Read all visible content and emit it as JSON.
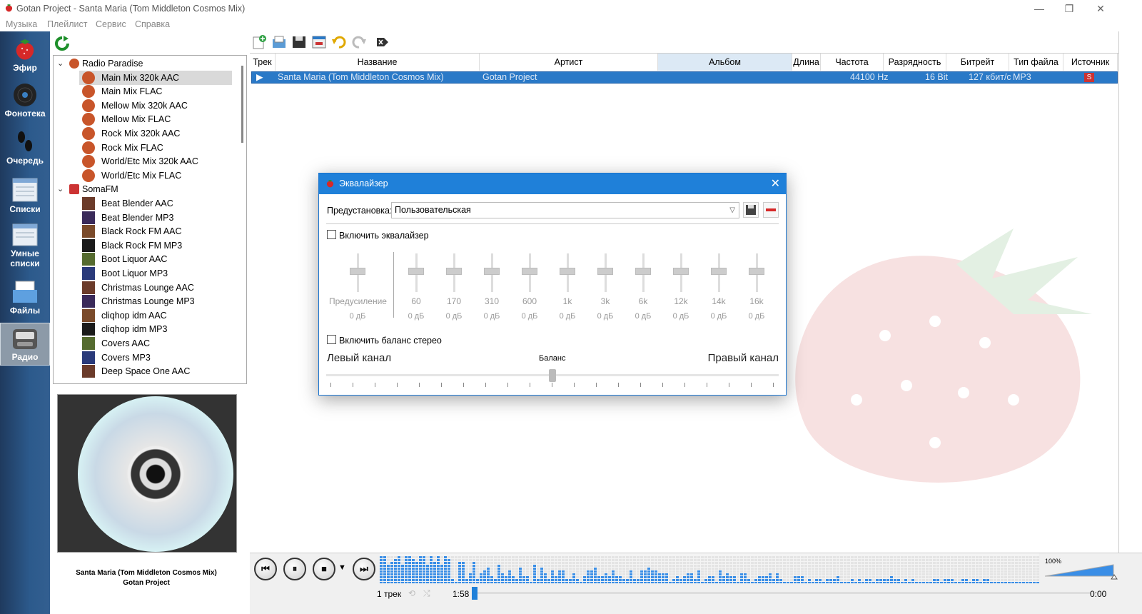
{
  "window": {
    "title": "Gotan Project - Santa Maria (Tom Middleton Cosmos Mix)",
    "minimize": "—",
    "maximize": "❐",
    "close": "✕"
  },
  "menu": [
    "Музыка",
    "Плейлист",
    "Сервис",
    "Справка"
  ],
  "nav": [
    {
      "label": "Эфир",
      "icon": "strawberry-icon"
    },
    {
      "label": "Фонотека",
      "icon": "vinyl-icon"
    },
    {
      "label": "Очередь",
      "icon": "footprints-icon"
    },
    {
      "label": "Списки",
      "icon": "playlists-icon"
    },
    {
      "label": "Умные списки",
      "icon": "smart-playlists-icon"
    },
    {
      "label": "Файлы",
      "icon": "files-icon"
    },
    {
      "label": "Радио",
      "icon": "radio-icon",
      "active": true
    }
  ],
  "tree": {
    "groups": [
      {
        "name": "Radio Paradise",
        "items": [
          "Main Mix 320k AAC",
          "Main Mix FLAC",
          "Mellow Mix 320k AAC",
          "Mellow Mix FLAC",
          "Rock Mix 320k AAC",
          "Rock Mix FLAC",
          "World/Etc Mix 320k AAC",
          "World/Etc Mix FLAC"
        ]
      },
      {
        "name": "SomaFM",
        "items": [
          "Beat Blender AAC",
          "Beat Blender MP3",
          "Black Rock FM AAC",
          "Black Rock FM MP3",
          "Boot Liquor AAC",
          "Boot Liquor MP3",
          "Christmas Lounge AAC",
          "Christmas Lounge MP3",
          "cliqhop idm AAC",
          "cliqhop idm MP3",
          "Covers AAC",
          "Covers MP3",
          "Deep Space One AAC"
        ]
      }
    ],
    "selected": "Main Mix 320k AAC"
  },
  "now_playing": {
    "title": "Santa Maria (Tom Middleton Cosmos Mix)",
    "artist": "Gotan Project"
  },
  "playlist": {
    "columns": [
      "Трек",
      "Название",
      "Артист",
      "Альбом",
      "Длина",
      "Частота",
      "Разрядность",
      "Битрейт",
      "Тип файла",
      "Источник"
    ],
    "sorted_column": "Альбом",
    "rows": [
      {
        "track": "",
        "title": "Santa Maria (Tom Middleton Cosmos Mix)",
        "artist": "Gotan Project",
        "album": "",
        "length": "",
        "rate": "44100 Hz",
        "bits": "16 Bit",
        "bitrate": "127 кбит/с",
        "type": "MP3",
        "source": "S"
      }
    ]
  },
  "equalizer": {
    "title": "Эквалайзер",
    "preset_label": "Предустановка:",
    "preset_value": "Пользовательская",
    "enable_eq": "Включить эквалайзер",
    "enable_eq_checked": false,
    "bands": [
      {
        "freq": "Предусиление",
        "gain": "0 дБ",
        "value": 0
      },
      {
        "freq": "60",
        "gain": "0 дБ",
        "value": 0
      },
      {
        "freq": "170",
        "gain": "0 дБ",
        "value": 0
      },
      {
        "freq": "310",
        "gain": "0 дБ",
        "value": 0
      },
      {
        "freq": "600",
        "gain": "0 дБ",
        "value": 0
      },
      {
        "freq": "1k",
        "gain": "0 дБ",
        "value": 0
      },
      {
        "freq": "3k",
        "gain": "0 дБ",
        "value": 0
      },
      {
        "freq": "6k",
        "gain": "0 дБ",
        "value": 0
      },
      {
        "freq": "12k",
        "gain": "0 дБ",
        "value": 0
      },
      {
        "freq": "14k",
        "gain": "0 дБ",
        "value": 0
      },
      {
        "freq": "16k",
        "gain": "0 дБ",
        "value": 0
      }
    ],
    "enable_balance": "Включить баланс стерео",
    "enable_balance_checked": false,
    "left_channel": "Левый канал",
    "balance": "Баланс",
    "right_channel": "Правый канал",
    "balance_value": 0.5
  },
  "player": {
    "track_count": "1 трек",
    "elapsed": "1:58",
    "remaining": "0:00",
    "volume": "100%",
    "volume_level": 1.0,
    "progress": 0.0
  },
  "colors": {
    "accent": "#1f80d9",
    "nav_bg": "#2c5a8c",
    "selection": "#2a79c7"
  }
}
